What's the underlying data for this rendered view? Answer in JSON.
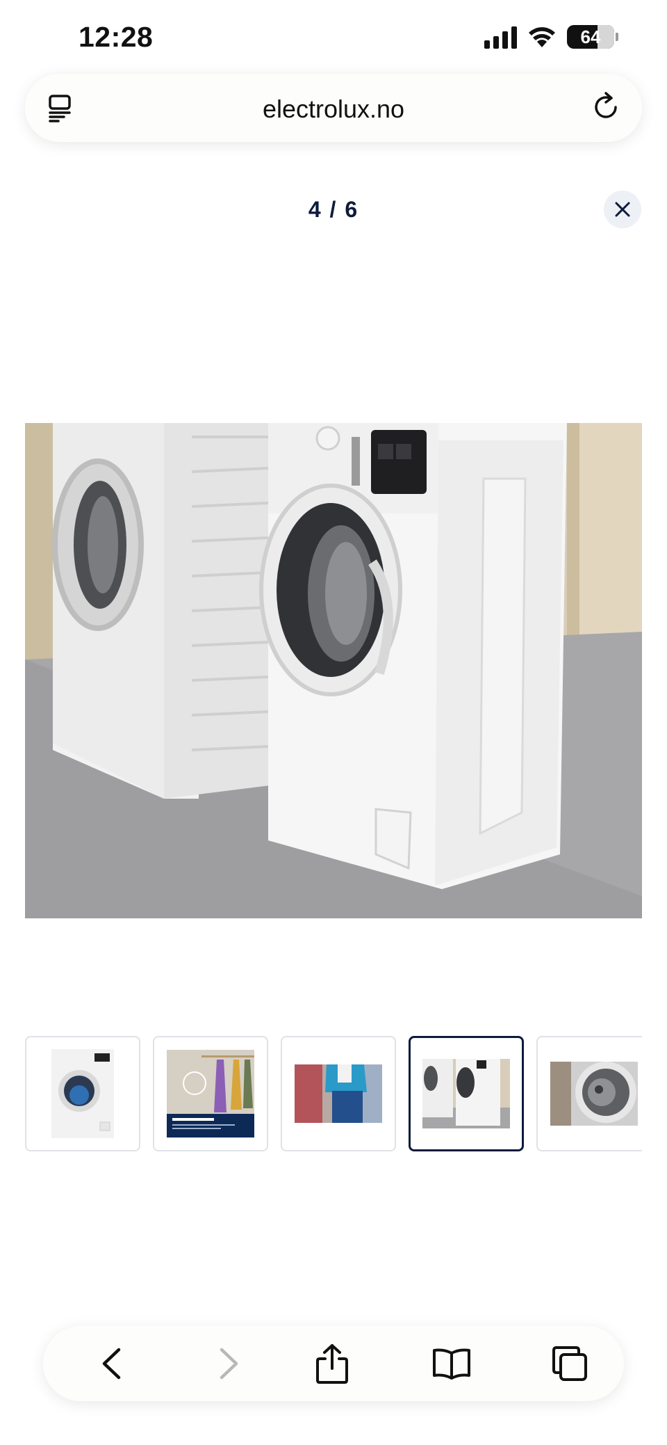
{
  "status_bar": {
    "time": "12:28",
    "battery_level": "64",
    "icons": [
      "cellular-signal-icon",
      "wifi-icon",
      "battery-icon"
    ]
  },
  "browser": {
    "url": "electrolux.no",
    "left_icon": "reader-mode-icon",
    "right_icon": "reload-icon"
  },
  "gallery": {
    "counter": "4 / 6",
    "close_icon": "close-icon",
    "current_index": 4,
    "total_images": 6,
    "thumbnails": [
      {
        "label": "washing-machine-front",
        "active": false
      },
      {
        "label": "time-manager-infographic",
        "active": false,
        "overlay_title": "Reduser vasketiden din",
        "overlay_text": "Time Manager® er en tidsfunksjon som gir deg kortere vasketid"
      },
      {
        "label": "person-in-denim",
        "active": false
      },
      {
        "label": "two-machines-side-by-side",
        "active": true
      },
      {
        "label": "drum-interior",
        "active": false
      }
    ]
  },
  "toolbar": {
    "items": [
      "back-icon",
      "forward-icon",
      "share-icon",
      "bookmarks-icon",
      "tabs-icon"
    ]
  },
  "colors": {
    "accent_navy": "#0d1b3d",
    "close_bg": "#edf0f4",
    "thumb_border": "#dfe2e6"
  }
}
